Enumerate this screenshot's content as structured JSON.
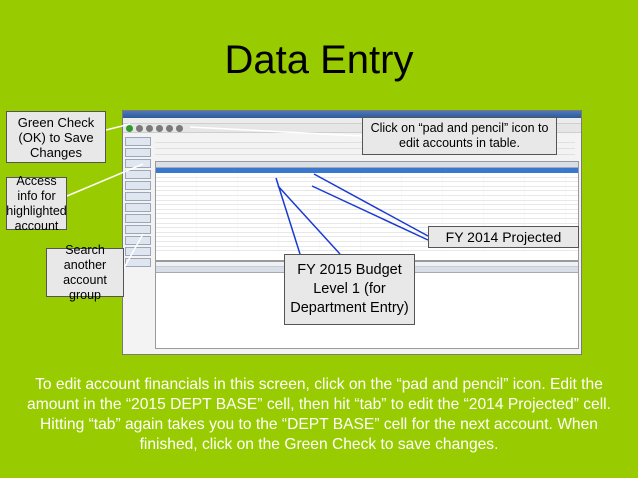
{
  "slide": {
    "title": "Data Entry",
    "callouts": {
      "green_check": "Green Check (OK) to Save Changes",
      "access_info": "Access info for highlighted account",
      "search": "Search another account group",
      "click_pad": "Click on “pad and pencil” icon to edit accounts in table.",
      "fy2014": "FY 2014 Projected",
      "fy2015": "FY 2015 Budget Level 1 (for Department Entry)"
    },
    "instructions": "To edit account financials in this screen, click on the “pad and pencil” icon.  Edit the amount in the “2015 DEPT BASE” cell, then hit “tab” to edit the “2014 Projected” cell.  Hitting “tab” again takes you to the “DEPT BASE” cell for the next account.  When finished, click on the Green Check to save changes."
  },
  "colors": {
    "background": "#99cc00",
    "callout_fill": "#e8e8e8",
    "instruction_text": "#ffffff"
  }
}
